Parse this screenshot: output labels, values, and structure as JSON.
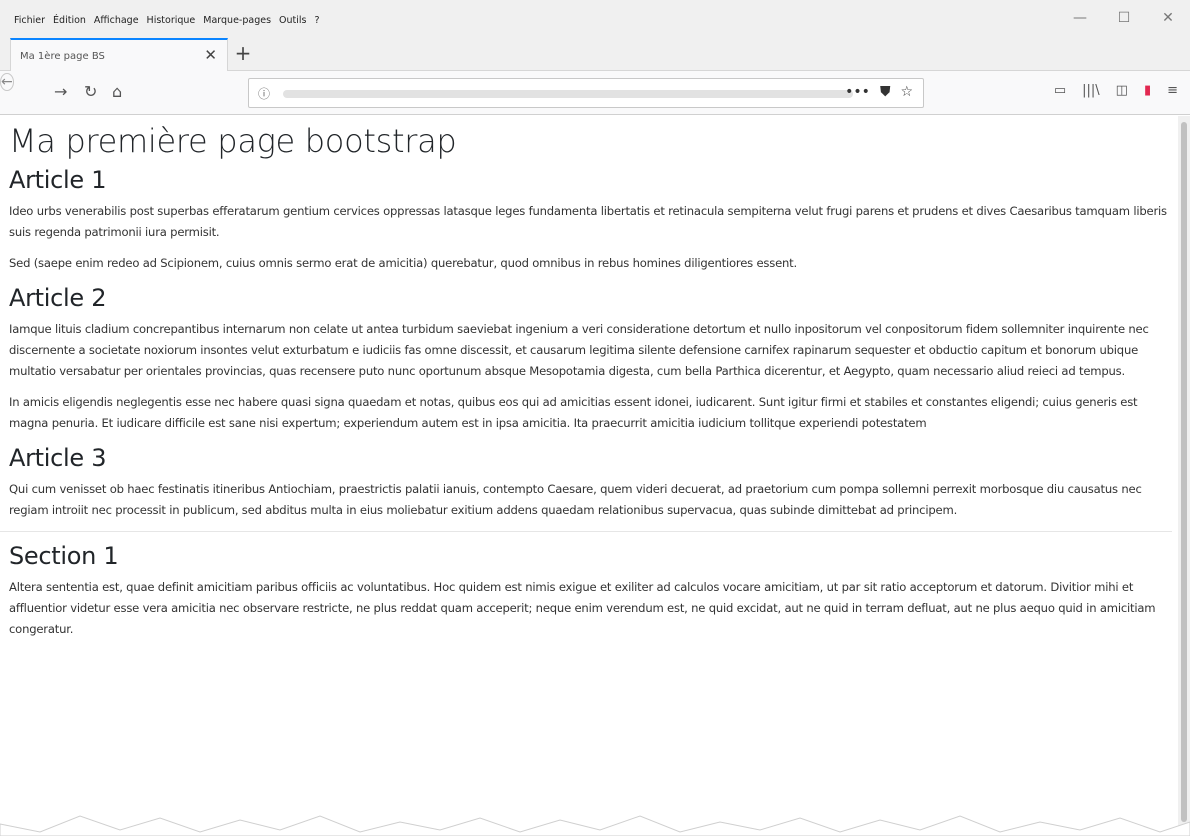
{
  "menu": {
    "items": [
      "Fichier",
      "Édition",
      "Affichage",
      "Historique",
      "Marque-pages",
      "Outils",
      "?"
    ]
  },
  "window_controls": {
    "minimize": "—",
    "maximize": "☐",
    "close": "✕"
  },
  "tab": {
    "title": "Ma 1ère page BS",
    "close": "✕",
    "new": "+"
  },
  "nav": {
    "back": "←",
    "forward": "→",
    "reload": "↻",
    "home": "⌂",
    "info": "ⓘ",
    "more": "•••",
    "pocket": "⛊",
    "bookmark": "☆",
    "reader": "▭",
    "library": "|||\\",
    "sidebar": "◫",
    "addon": "▮",
    "menu": "≡"
  },
  "page": {
    "title": "Ma première page bootstrap",
    "articles": [
      {
        "heading": "Article 1",
        "paragraphs": [
          "Ideo urbs venerabilis post superbas efferatarum gentium cervices oppressas latasque leges fundamenta libertatis et retinacula sempiterna velut frugi parens et prudens et dives Caesaribus tamquam liberis suis regenda patrimonii iura permisit.",
          "Sed (saepe enim redeo ad Scipionem, cuius omnis sermo erat de amicitia) querebatur, quod omnibus in rebus homines diligentiores essent."
        ]
      },
      {
        "heading": "Article 2",
        "paragraphs": [
          "Iamque lituis cladium concrepantibus internarum non celate ut antea turbidum saeviebat ingenium a veri consideratione detortum et nullo inpositorum vel conpositorum fidem sollemniter inquirente nec discernente a societate noxiorum insontes velut exturbatum e iudiciis fas omne discessit, et causarum legitima silente defensione carnifex rapinarum sequester et obductio capitum et bonorum ubique multatio versabatur per orientales provincias, quas recensere puto nunc oportunum absque Mesopotamia digesta, cum bella Parthica dicerentur, et Aegypto, quam necessario aliud reieci ad tempus.",
          "In amicis eligendis neglegentis esse nec habere quasi signa quaedam et notas, quibus eos qui ad amicitias essent idonei, iudicarent. Sunt igitur firmi et stabiles et constantes eligendi; cuius generis est magna penuria. Et iudicare difficile est sane nisi expertum; experiendum autem est in ipsa amicitia. Ita praecurrit amicitia iudicium tollitque experiendi potestatem"
        ]
      },
      {
        "heading": "Article 3",
        "paragraphs": [
          "Qui cum venisset ob haec festinatis itineribus Antiochiam, praestrictis palatii ianuis, contempto Caesare, quem videri decuerat, ad praetorium cum pompa sollemni perrexit morbosque diu causatus nec regiam introiit nec processit in publicum, sed abditus multa in eius moliebatur exitium addens quaedam relationibus supervacua, quas subinde dimittebat ad principem."
        ]
      }
    ],
    "section": {
      "heading": "Section 1",
      "paragraphs": [
        "Altera sententia est, quae definit amicitiam paribus officiis ac voluntatibus. Hoc quidem est nimis exigue et exiliter ad calculos vocare amicitiam, ut par sit ratio acceptorum et datorum. Divitior mihi et affluentior videtur esse vera amicitia nec observare restricte, ne plus reddat quam acceperit; neque enim verendum est, ne quid excidat, aut ne quid in terram defluat, aut ne plus aequo quid in amicitiam congeratur."
      ]
    }
  },
  "colors": {
    "tab_accent": "#0a84ff",
    "chrome_bg": "#f0f0f0",
    "nav_bg": "#f9f9fa"
  }
}
